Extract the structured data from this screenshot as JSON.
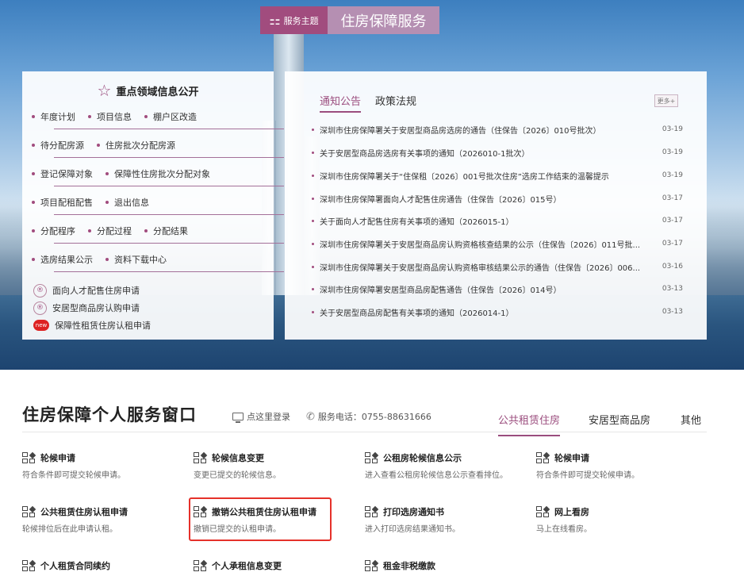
{
  "theme": {
    "tag": "服务主题",
    "title": "住房保障服务"
  },
  "left_panel": {
    "title": "重点领域信息公开",
    "rows": [
      [
        "年度计划",
        "项目信息",
        "棚户区改造"
      ],
      [
        "待分配房源",
        "住房批次分配房源"
      ],
      [
        "登记保障对象",
        "保障性住房批次分配对象"
      ],
      [
        "项目配租配售",
        "退出信息"
      ],
      [
        "分配程序",
        "分配过程",
        "分配结果"
      ],
      [
        "选房结果公示",
        "资料下载中心"
      ]
    ],
    "applications": [
      "面向人才配售住房申请",
      "安居型商品房认购申请",
      "保障性租赁住房认租申请"
    ],
    "new_badge": "new"
  },
  "right_panel": {
    "tabs": [
      "通知公告",
      "政策法规"
    ],
    "more": "更多+",
    "news": [
      {
        "title": "深圳市住房保障署关于安居型商品房选房的通告（住保告〔2026〕010号批次）",
        "date": "03-19"
      },
      {
        "title": "关于安居型商品房选房有关事项的通知（2026010-1批次）",
        "date": "03-19"
      },
      {
        "title": "深圳市住房保障署关于“住保租〔2026〕001号批次住房”选房工作结束的温馨提示",
        "date": "03-19"
      },
      {
        "title": "深圳市住房保障署面向人才配售住房通告（住保告〔2026〕015号）",
        "date": "03-17"
      },
      {
        "title": "关于面向人才配售住房有关事项的通知（2026015-1）",
        "date": "03-17"
      },
      {
        "title": "深圳市住房保障署关于安居型商品房认购资格核查结果的公示（住保告〔2026〕011号批...",
        "date": "03-17"
      },
      {
        "title": "深圳市住房保障署关于安居型商品房认购资格审核结果公示的通告（住保告〔2026〕006...",
        "date": "03-16"
      },
      {
        "title": "深圳市住房保障署安居型商品房配售通告（住保告〔2026〕014号）",
        "date": "03-13"
      },
      {
        "title": "关于安居型商品房配售有关事项的通知（2026014-1）",
        "date": "03-13"
      }
    ]
  },
  "service": {
    "title": "住房保障个人服务窗口",
    "login": "点这里登录",
    "phone": "服务电话：0755-88631666",
    "tabs": [
      "公共租赁住房",
      "安居型商品房",
      "其他"
    ],
    "items": [
      {
        "title": "轮候申请",
        "desc": "符合条件即可提交轮候申请。"
      },
      {
        "title": "轮候信息变更",
        "desc": "变更已提交的轮候信息。"
      },
      {
        "title": "公租房轮候信息公示",
        "desc": "进入查看公租房轮候信息公示查看排位。"
      },
      {
        "title": "轮候申请",
        "desc": "符合条件即可提交轮候申请。"
      },
      {
        "title": "公共租赁住房认租申请",
        "desc": "轮候排位后在此申请认租。"
      },
      {
        "title": "撤销公共租赁住房认租申请",
        "desc": "撤销已提交的认租申请。"
      },
      {
        "title": "打印选房通知书",
        "desc": "进入打印选房结果通知书。"
      },
      {
        "title": "网上看房",
        "desc": "马上在线看房。"
      },
      {
        "title": "个人租赁合同续约",
        "desc": ""
      },
      {
        "title": "个人承租信息变更",
        "desc": ""
      },
      {
        "title": "租金非税缴款",
        "desc": ""
      }
    ]
  },
  "colors": {
    "accent": "#9b4d7e",
    "highlight": "#e5312a"
  }
}
